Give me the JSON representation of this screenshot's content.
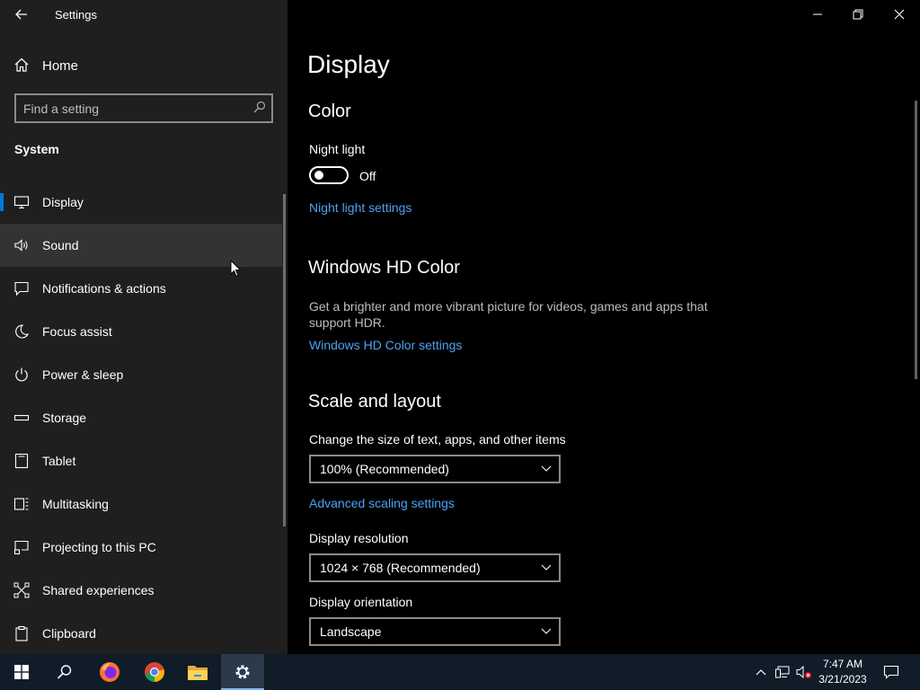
{
  "window": {
    "title": "Settings"
  },
  "sidebar": {
    "home_label": "Home",
    "search_placeholder": "Find a setting",
    "section_label": "System",
    "items": [
      {
        "label": "Display",
        "icon": "monitor-icon"
      },
      {
        "label": "Sound",
        "icon": "speaker-icon"
      },
      {
        "label": "Notifications & actions",
        "icon": "notification-icon"
      },
      {
        "label": "Focus assist",
        "icon": "moon-icon"
      },
      {
        "label": "Power & sleep",
        "icon": "power-icon"
      },
      {
        "label": "Storage",
        "icon": "storage-icon"
      },
      {
        "label": "Tablet",
        "icon": "tablet-icon"
      },
      {
        "label": "Multitasking",
        "icon": "multitasking-icon"
      },
      {
        "label": "Projecting to this PC",
        "icon": "projecting-icon"
      },
      {
        "label": "Shared experiences",
        "icon": "shared-icon"
      },
      {
        "label": "Clipboard",
        "icon": "clipboard-icon"
      }
    ]
  },
  "main": {
    "page_title": "Display",
    "color": {
      "heading": "Color",
      "night_light_label": "Night light",
      "night_light_state": "Off",
      "night_light_link": "Night light settings"
    },
    "hdr": {
      "heading": "Windows HD Color",
      "description": "Get a brighter and more vibrant picture for videos, games and apps that support HDR.",
      "link": "Windows HD Color settings"
    },
    "scale": {
      "heading": "Scale and layout",
      "size_label": "Change the size of text, apps, and other items",
      "size_value": "100% (Recommended)",
      "advanced_link": "Advanced scaling settings",
      "resolution_label": "Display resolution",
      "resolution_value": "1024 × 768 (Recommended)",
      "orientation_label": "Display orientation",
      "orientation_value": "Landscape"
    }
  },
  "taskbar": {
    "time": "7:47 AM",
    "date": "3/21/2023",
    "apps": [
      "windows-start-icon",
      "search-icon",
      "firefox-icon",
      "chrome-icon",
      "file-explorer-icon",
      "settings-gear-icon"
    ]
  },
  "colors": {
    "accent": "#0078d7",
    "link": "#4ea1f2",
    "sidebar_bg": "#1f1f1f",
    "main_bg": "#000000",
    "taskbar_bg": "#101c28"
  }
}
